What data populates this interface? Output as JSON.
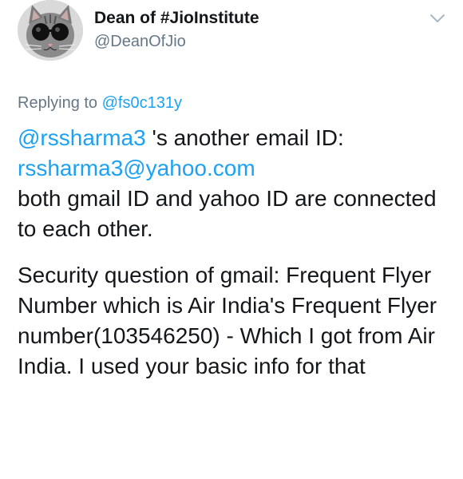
{
  "user": {
    "display_name": "Dean of #JioInstitute",
    "handle": "@DeanOfJio",
    "avatar_icon": "cat-sunglasses-avatar"
  },
  "reply": {
    "prefix": "Replying to ",
    "target": "@fs0c131y"
  },
  "tweet": {
    "mention": "@rssharma3",
    "mention_suffix": " 's another email ID:",
    "email_link": "rssharma3@yahoo.com",
    "line_connected": "both gmail ID and yahoo ID are connected to each other.",
    "paragraph_security": "Security question of gmail: Frequent Flyer Number which is Air India's Frequent Flyer number(103546250) - Which I got from Air India. I used your basic info for that"
  },
  "colors": {
    "link": "#1da1f2",
    "secondary_text": "#657786",
    "primary_text": "#14171a"
  }
}
